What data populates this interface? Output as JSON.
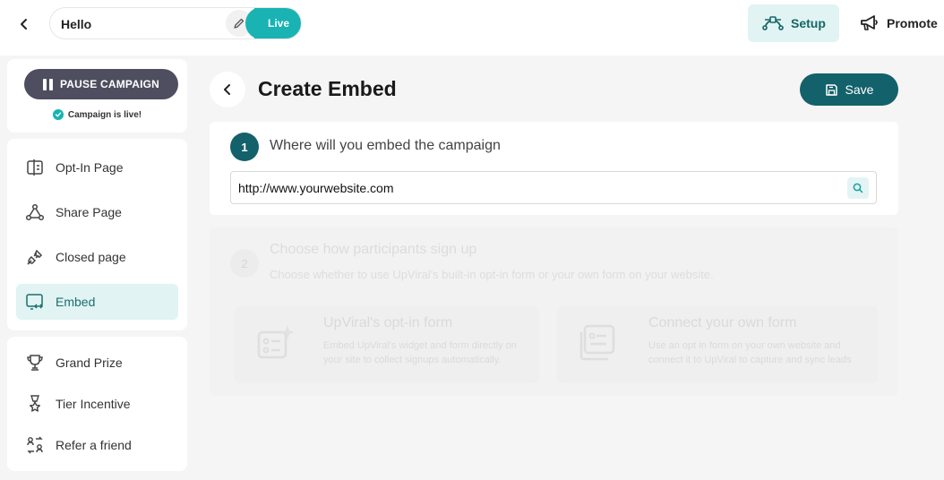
{
  "header": {
    "campaign_name": "Hello",
    "live_label": "Live",
    "setup_label": "Setup",
    "promote_label": "Promote"
  },
  "sidebar": {
    "pause_label": "PAUSE CAMPAIGN",
    "status_text": "Campaign is live!",
    "pages": [
      {
        "label": "Opt-In Page",
        "icon": "opt-in-page-icon"
      },
      {
        "label": "Share Page",
        "icon": "share-nodes-icon"
      },
      {
        "label": "Closed page",
        "icon": "unplug-icon"
      },
      {
        "label": "Embed",
        "icon": "embed-code-icon",
        "active": true
      }
    ],
    "rewards": [
      {
        "label": "Grand Prize",
        "icon": "trophy-icon"
      },
      {
        "label": "Tier Incentive",
        "icon": "award-ribbon-icon"
      },
      {
        "label": "Refer a friend",
        "icon": "refer-swap-icon"
      }
    ]
  },
  "main": {
    "title": "Create Embed",
    "save_label": "Save",
    "step1": {
      "number": "1",
      "title": "Where will you embed the campaign",
      "url_value": "http://www.yourwebsite.com"
    },
    "step2": {
      "number": "2",
      "title": "Choose how participants sign up",
      "subtitle": "Choose whether to use UpViral's built-in opt-in form or your own form on your website.",
      "options": [
        {
          "title": "UpViral's opt-in form",
          "desc_line1": "Embed UpViral's widget and form directly on",
          "desc_line2": "your site to collect signups automatically."
        },
        {
          "title": "Connect your own form",
          "desc_line1": "Use an opt in form on your own website and",
          "desc_line2": "connect it to UpViral to capture and sync leads"
        }
      ]
    }
  },
  "colors": {
    "accent_teal": "#19b3b3",
    "dark_teal": "#13616a",
    "active_bg": "#e1f3f3",
    "pause_bg": "#4e4e60"
  }
}
